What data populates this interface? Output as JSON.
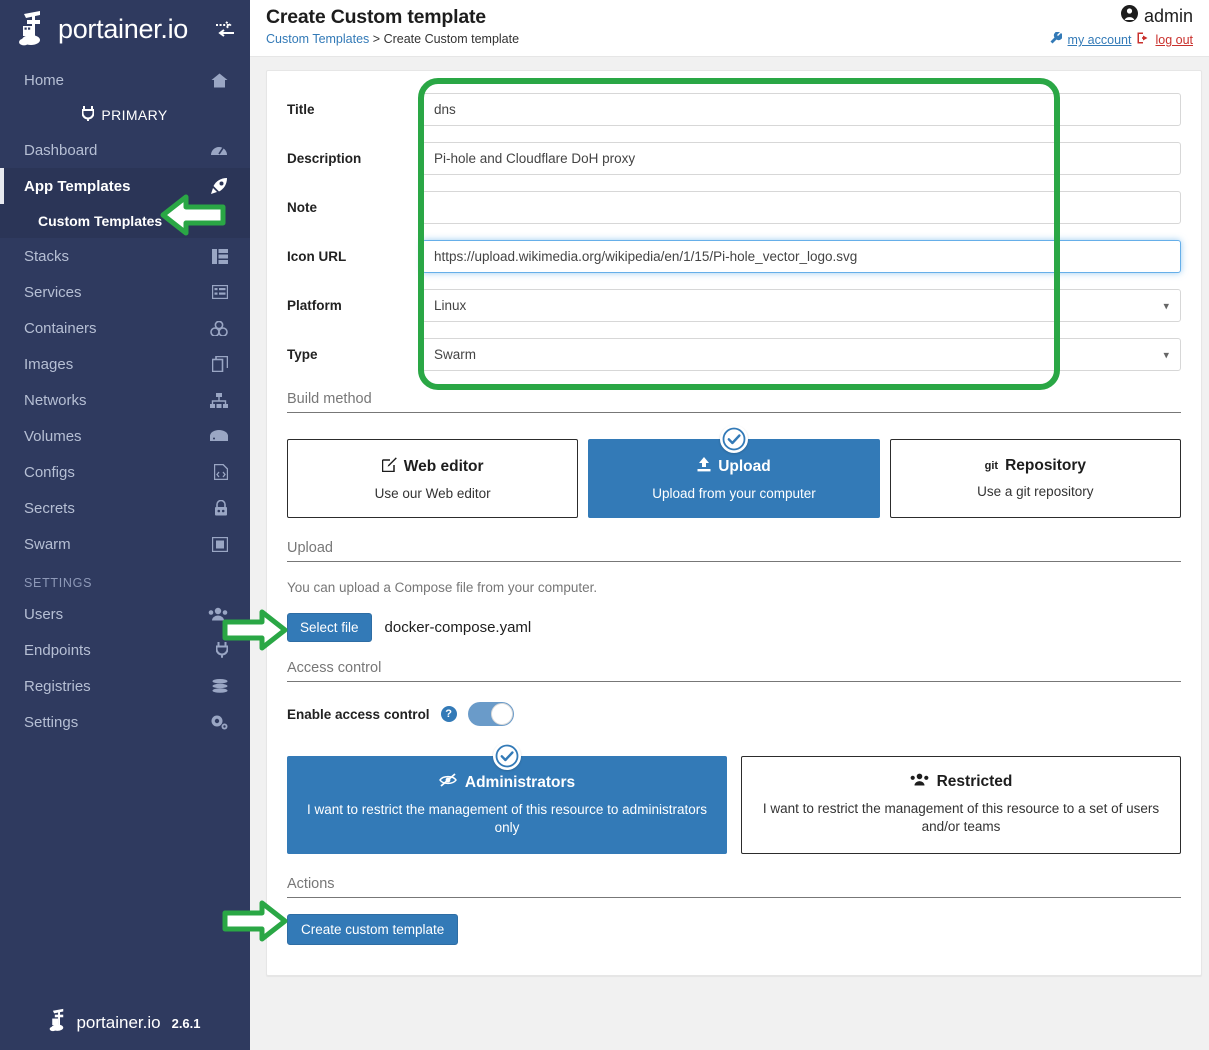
{
  "sidebar": {
    "brand": "portainer.io",
    "toggle_icon": "collapse-toggle-icon",
    "primary_label": "PRIMARY",
    "items": [
      {
        "label": "Home",
        "icon": "home-icon",
        "state": "normal"
      },
      {
        "label": "Dashboard",
        "icon": "dashboard-icon",
        "state": "normal"
      },
      {
        "label": "App Templates",
        "icon": "rocket-icon",
        "state": "active"
      },
      {
        "label": "Custom Templates",
        "icon": "",
        "state": "sub"
      },
      {
        "label": "Stacks",
        "icon": "stacks-icon",
        "state": "normal"
      },
      {
        "label": "Services",
        "icon": "services-icon",
        "state": "normal"
      },
      {
        "label": "Containers",
        "icon": "containers-icon",
        "state": "normal"
      },
      {
        "label": "Images",
        "icon": "images-icon",
        "state": "normal"
      },
      {
        "label": "Networks",
        "icon": "networks-icon",
        "state": "normal"
      },
      {
        "label": "Volumes",
        "icon": "volumes-icon",
        "state": "normal"
      },
      {
        "label": "Configs",
        "icon": "configs-icon",
        "state": "normal"
      },
      {
        "label": "Secrets",
        "icon": "secrets-icon",
        "state": "normal"
      },
      {
        "label": "Swarm",
        "icon": "swarm-icon",
        "state": "normal"
      }
    ],
    "settings_section": "SETTINGS",
    "settings_items": [
      {
        "label": "Users",
        "icon": "users-icon"
      },
      {
        "label": "Endpoints",
        "icon": "plug-icon"
      },
      {
        "label": "Registries",
        "icon": "database-icon"
      },
      {
        "label": "Settings",
        "icon": "gears-icon"
      }
    ],
    "footer_brand": "portainer.io",
    "footer_version": "2.6.1"
  },
  "header": {
    "title": "Create Custom template",
    "breadcrumb_parent": "Custom Templates",
    "breadcrumb_separator": ">",
    "breadcrumb_current": "Create Custom template",
    "user_name": "admin",
    "user_icon": "user-circle-icon",
    "my_account_label": "my account",
    "my_account_icon": "wrench-icon",
    "log_out_label": "log out",
    "log_out_icon": "sign-out-icon"
  },
  "form": {
    "fields": [
      {
        "label": "Title",
        "value": "dns",
        "type": "text",
        "focused": false
      },
      {
        "label": "Description",
        "value": "Pi-hole and Cloudflare DoH proxy",
        "type": "text",
        "focused": false
      },
      {
        "label": "Note",
        "value": "",
        "type": "text",
        "focused": false
      },
      {
        "label": "Icon URL",
        "value": "https://upload.wikimedia.org/wikipedia/en/1/15/Pi-hole_vector_logo.svg",
        "type": "text",
        "focused": true
      },
      {
        "label": "Platform",
        "value": "Linux",
        "type": "select",
        "focused": false
      },
      {
        "label": "Type",
        "value": "Swarm",
        "type": "select",
        "focused": false
      }
    ]
  },
  "build_method": {
    "heading": "Build method",
    "options": [
      {
        "title": "Web editor",
        "subtitle": "Use our Web editor",
        "icon": "pencil-square-icon",
        "selected": false
      },
      {
        "title": "Upload",
        "subtitle": "Upload from your computer",
        "icon": "upload-icon",
        "selected": true
      },
      {
        "title": "Repository",
        "subtitle": "Use a git repository",
        "icon": "git-icon",
        "selected": false
      }
    ]
  },
  "upload": {
    "heading": "Upload",
    "hint": "You can upload a Compose file from your computer.",
    "select_file_label": "Select file",
    "file_name": "docker-compose.yaml"
  },
  "access_control": {
    "heading": "Access control",
    "enable_label": "Enable access control",
    "help_icon": "question-mark-icon",
    "toggle_on": true,
    "options": [
      {
        "title": "Administrators",
        "subtitle": "I want to restrict the management of this resource to administrators only",
        "icon": "eye-slash-icon",
        "selected": true
      },
      {
        "title": "Restricted",
        "subtitle": "I want to restrict the management of this resource to a set of users and/or teams",
        "icon": "users-group-icon",
        "selected": false
      }
    ]
  },
  "actions": {
    "heading": "Actions",
    "create_button_label": "Create custom template"
  },
  "annotations": {
    "highlight_color": "#2aa745",
    "arrows": [
      {
        "name": "arrow-to-custom-templates",
        "direction": "left"
      },
      {
        "name": "arrow-to-select-file",
        "direction": "right"
      },
      {
        "name": "arrow-to-create-button",
        "direction": "right"
      }
    ],
    "highlight_box": "form-fields-highlight"
  },
  "colors": {
    "sidebar_bg": "#2f3a5f",
    "accent_blue": "#337ab7",
    "annotation_green": "#2aa745",
    "logout_red": "#c9302c"
  }
}
